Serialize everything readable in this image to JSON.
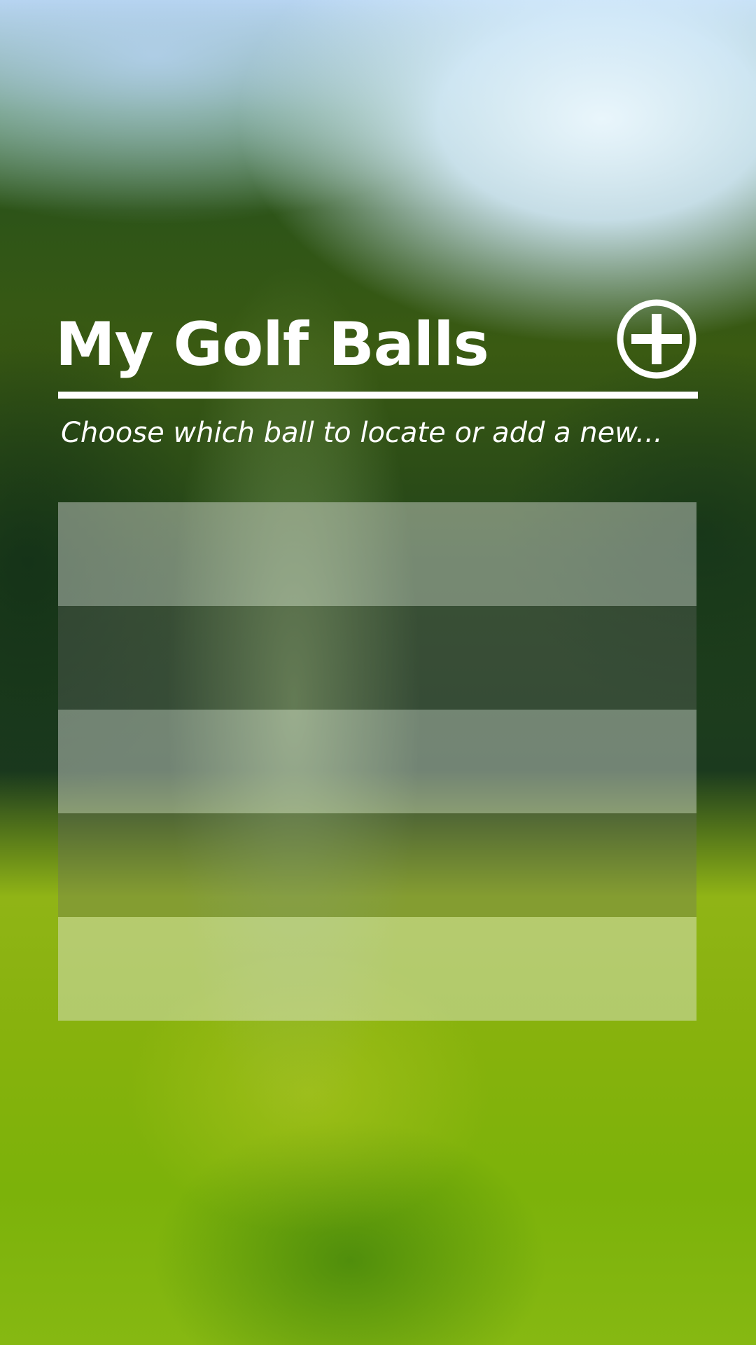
{
  "header": {
    "title": "My Golf Balls",
    "add_icon": "plus-circle-icon"
  },
  "subtitle": "Choose which ball to locate or add a new...",
  "ball_list": {
    "rows": [
      {
        "label": "",
        "shade": "light"
      },
      {
        "label": "",
        "shade": "dark"
      },
      {
        "label": "",
        "shade": "light"
      },
      {
        "label": "",
        "shade": "dark"
      },
      {
        "label": "",
        "shade": "light"
      }
    ]
  },
  "colors": {
    "text": "#ffffff",
    "row_light": "rgba(235,235,235,0.42)",
    "row_dark": "rgba(110,110,110,0.32)"
  }
}
